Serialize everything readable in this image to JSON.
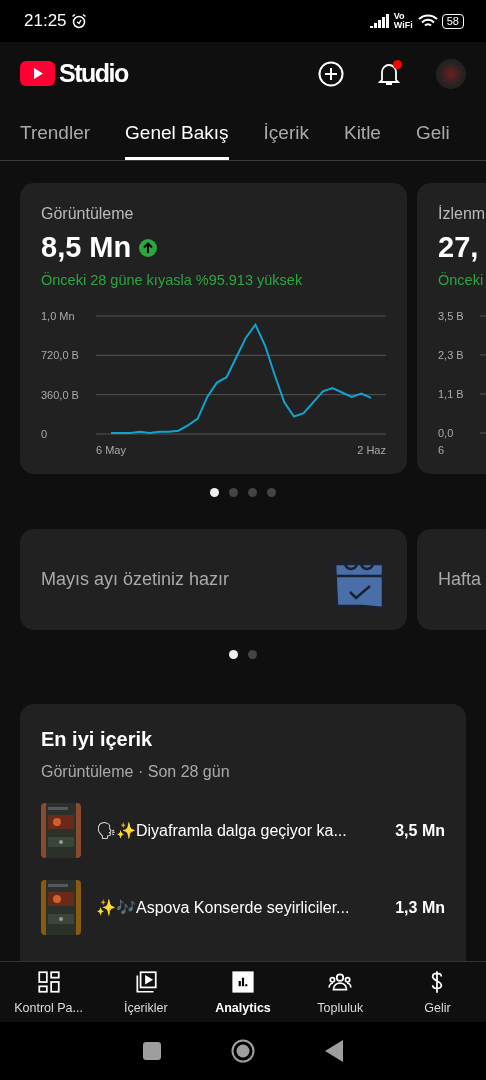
{
  "status_bar": {
    "time": "21:25",
    "network": "Vo WiFi",
    "battery": "58"
  },
  "header": {
    "logo_text": "Studio",
    "has_notification": true
  },
  "tabs": [
    {
      "label": "Trendler",
      "selected": false
    },
    {
      "label": "Genel Bakış",
      "selected": true
    },
    {
      "label": "İçerik",
      "selected": false
    },
    {
      "label": "Kitle",
      "selected": false
    },
    {
      "label": "Geli",
      "selected": false
    }
  ],
  "metric_cards": [
    {
      "title": "Görüntüleme",
      "value": "8,5 Mn",
      "increased": true,
      "chart_top_label": "1,0 Mn",
      "comparison": "Önceki 28 güne kıyasla %95.913 yüksek",
      "chart_data": {
        "type": "line",
        "categories": [
          "6 May",
          null,
          null,
          null,
          null,
          null,
          null,
          null,
          null,
          null,
          null,
          null,
          null,
          null,
          null,
          null,
          null,
          null,
          null,
          null,
          null,
          null,
          null,
          null,
          null,
          null,
          null,
          "2 Haz"
        ],
        "ylim": [
          0,
          1080
        ],
        "yticks": [
          {
            "value": 0,
            "label": "0"
          },
          {
            "value": 360,
            "label": "360,0 B"
          },
          {
            "value": 720,
            "label": "720,0 B"
          }
        ],
        "series": [
          {
            "color": "#12a4d0",
            "values": [
              10,
              10,
              10,
              20,
              10,
              20,
              20,
              30,
              80,
              140,
              340,
              470,
              520,
              700,
              880,
              1000,
              810,
              540,
              290,
              160,
              190,
              290,
              390,
              420,
              380,
              340,
              370,
              330
            ]
          }
        ]
      }
    },
    {
      "title": "İzlenm",
      "value": "27,",
      "comparison": "Önceki",
      "ytick_labels": [
        "3,5 B",
        "2,3 B",
        "1,1 B",
        "0,0"
      ],
      "xtick_label": "6"
    }
  ],
  "metric_dots": [
    {
      "selected": true
    },
    {
      "selected": false
    },
    {
      "selected": false
    },
    {
      "selected": false
    }
  ],
  "summary_cards": [
    {
      "text": "Mayıs ayı özetiniz hazır"
    },
    {
      "text": "Hafta"
    }
  ],
  "summary_dots": [
    {
      "selected": true
    },
    {
      "selected": false
    }
  ],
  "top_content": {
    "title": "En iyi içerik",
    "subtitle": "Görüntüleme · Son 28 gün",
    "items": [
      {
        "title": "🗣✨Diyaframla dalga geçiyor ka...",
        "views": "3,5 Mn"
      },
      {
        "title": "✨🎶Aspova Konserde seyirliciler...",
        "views": "1,3 Mn"
      }
    ]
  },
  "bottom_nav": [
    {
      "kind": "dashboard",
      "label": "Kontrol Pa...",
      "selected": false
    },
    {
      "kind": "content",
      "label": "İçerikler",
      "selected": false
    },
    {
      "kind": "analytics",
      "label": "Analytics",
      "selected": true
    },
    {
      "kind": "community",
      "label": "Topluluk",
      "selected": false
    },
    {
      "kind": "earn",
      "label": "Gelir",
      "selected": false
    }
  ]
}
